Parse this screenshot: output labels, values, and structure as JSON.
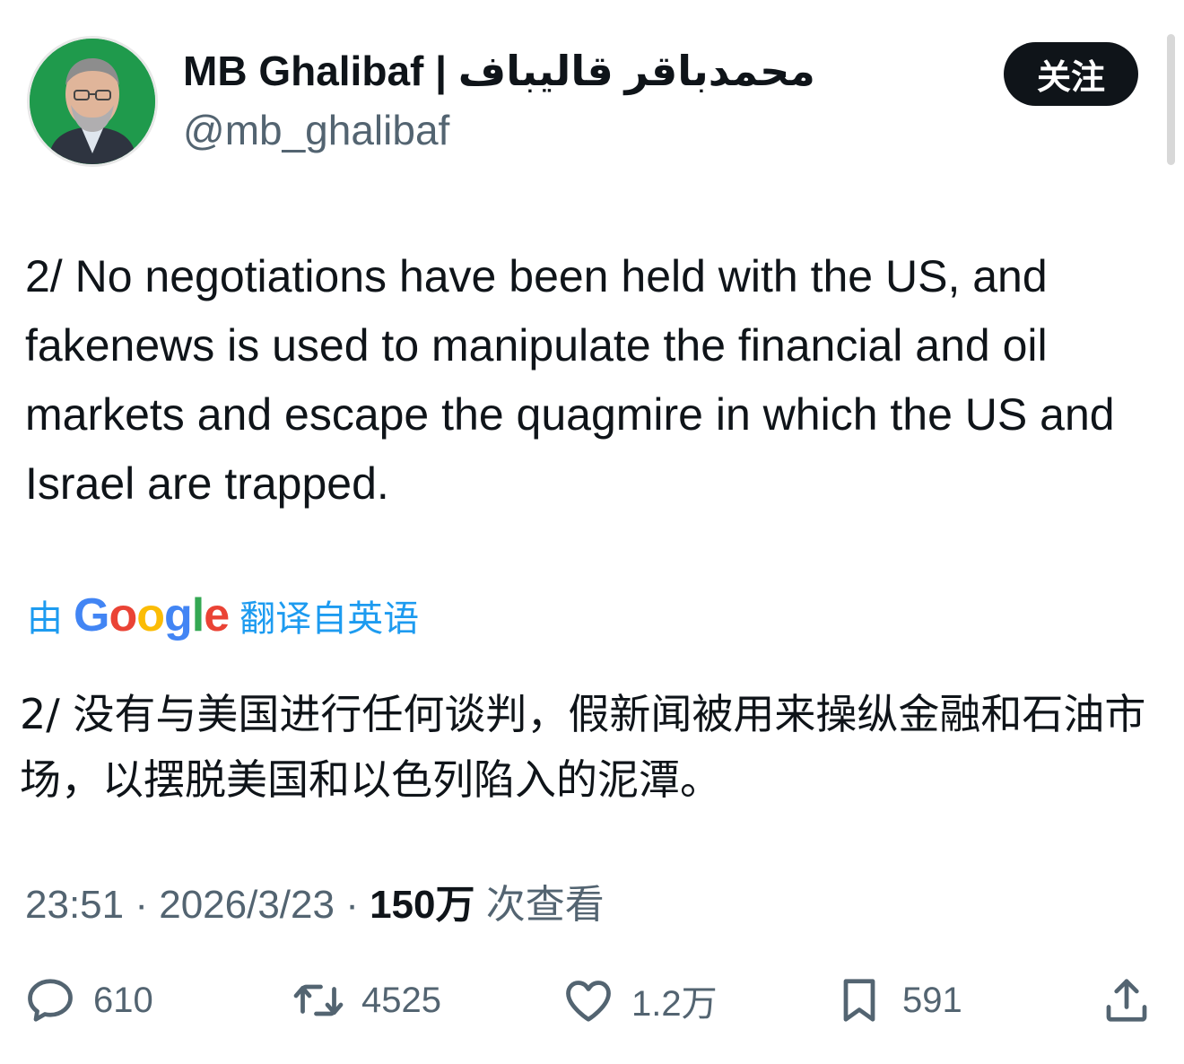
{
  "author": {
    "display_name": "MB Ghalibaf | محمدباقر قالیباف",
    "handle": "@mb_ghalibaf",
    "follow_label": "关注"
  },
  "tweet": {
    "text": "2/ No negotiations have been held with the US, and fakenews is used to manipulate the financial and oil markets and escape the quagmire in which the US and Israel are trapped.",
    "translation": {
      "prefix": "由",
      "provider": "Google",
      "suffix": "翻译自英语",
      "text": "2/ 没有与美国进行任何谈判，假新闻被用来操纵金融和石油市场，以摆脱美国和以色列陷入的泥潭。"
    },
    "time": "23:51",
    "date": "2026/3/23",
    "views_count": "150万",
    "views_label": "次查看"
  },
  "actions": {
    "replies": "610",
    "retweets": "4525",
    "likes": "1.2万",
    "bookmarks": "591"
  },
  "icons": {
    "reply": "reply-icon",
    "retweet": "retweet-icon",
    "like": "heart-icon",
    "bookmark": "bookmark-icon",
    "share": "share-icon"
  },
  "colors": {
    "accent": "#1d9bf0",
    "text": "#0f1419",
    "secondary": "#536471",
    "google_blue": "#4285F4",
    "google_red": "#EA4335",
    "google_yellow": "#FBBC05",
    "google_green": "#34A853"
  }
}
